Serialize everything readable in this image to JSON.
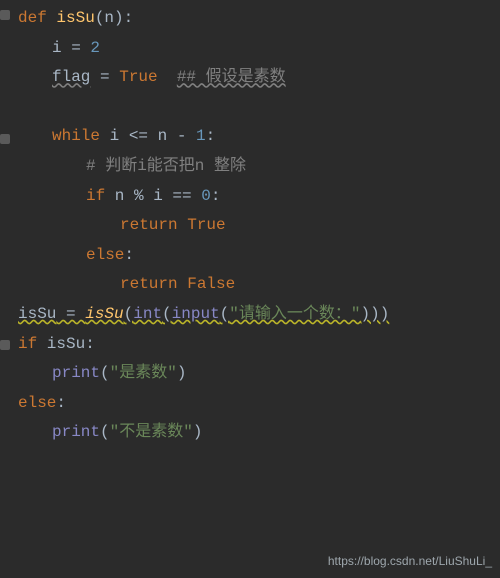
{
  "code": {
    "l1_def": "def",
    "l1_fn": "isSu",
    "l1_open": "(n):",
    "l2": "i = ",
    "l2_num": "2",
    "l3_var": "flag",
    "l3_eq": " = ",
    "l3_true": "True",
    "l3_comment": "## 假设是素数",
    "l5_while": "while",
    "l5_cond": " i <= n - ",
    "l5_num": "1",
    "l5_colon": ":",
    "l6_comment": "# 判断i能否把n 整除",
    "l7_if": "if",
    "l7_cond": " n % i == ",
    "l7_num": "0",
    "l7_colon": ":",
    "l8_return": "return True",
    "l9_else": "else",
    "l9_colon": ":",
    "l10_return": "return False",
    "l11_lhs": "isSu",
    "l11_eq": " = ",
    "l11_fn": "isSu",
    "l11_open": "(",
    "l11_int": "int",
    "l11_open2": "(",
    "l11_input": "input",
    "l11_open3": "(",
    "l11_str": "\"请输入一个数：\"",
    "l11_close": ")))",
    "l12_if": "if",
    "l12_cond": " isSu:",
    "l13_print": "print",
    "l13_open": "(",
    "l13_str": "\"是素数\"",
    "l13_close": ")",
    "l14_else": "else",
    "l14_colon": ":",
    "l15_print": "print",
    "l15_open": "(",
    "l15_str": "\"不是素数\"",
    "l15_close": ")"
  },
  "watermark": "https://blog.csdn.net/LiuShuLi_"
}
